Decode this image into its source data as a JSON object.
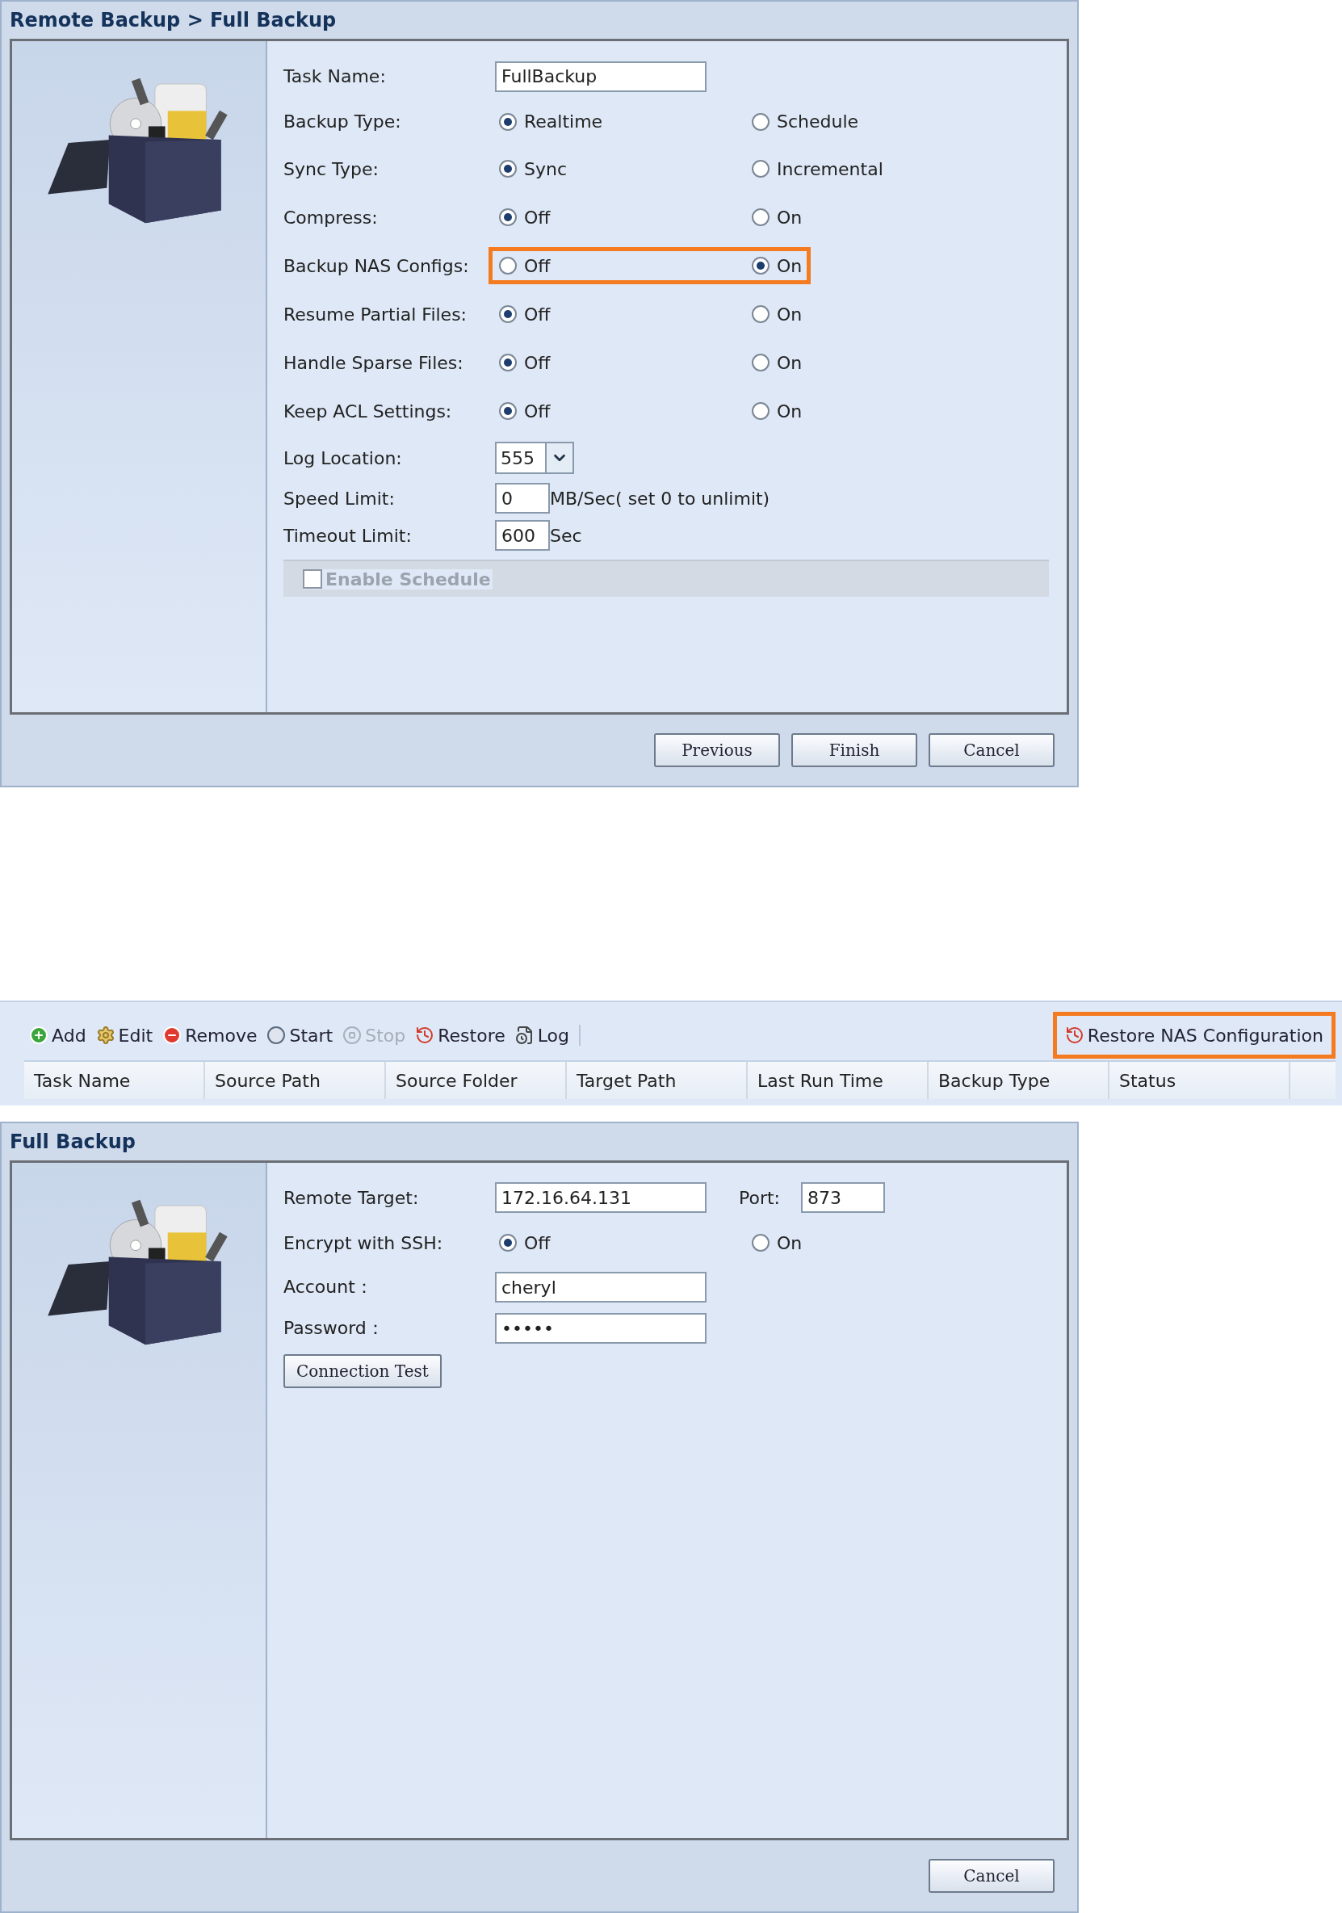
{
  "backup_settings_dialog": {
    "title": "Remote Backup > Full Backup",
    "fields": [
      {
        "kind": "text",
        "label": "Task Name:",
        "value": "FullBackup"
      },
      {
        "kind": "radio",
        "label": "Backup Type:",
        "highlighted": false,
        "options": [
          {
            "label": "Realtime",
            "selected": true
          },
          {
            "label": "Schedule",
            "selected": false
          }
        ]
      },
      {
        "kind": "radio",
        "label": "Sync Type:",
        "highlighted": false,
        "options": [
          {
            "label": "Sync",
            "selected": true
          },
          {
            "label": "Incremental",
            "selected": false
          }
        ]
      },
      {
        "kind": "radio",
        "label": "Compress:",
        "highlighted": false,
        "options": [
          {
            "label": "Off",
            "selected": true
          },
          {
            "label": "On",
            "selected": false
          }
        ]
      },
      {
        "kind": "radio",
        "label": "Backup NAS Configs:",
        "highlighted": true,
        "options": [
          {
            "label": "Off",
            "selected": false
          },
          {
            "label": "On",
            "selected": true
          }
        ]
      },
      {
        "kind": "radio",
        "label": "Resume Partial Files:",
        "highlighted": false,
        "options": [
          {
            "label": "Off",
            "selected": true
          },
          {
            "label": "On",
            "selected": false
          }
        ]
      },
      {
        "kind": "radio",
        "label": "Handle Sparse Files:",
        "highlighted": false,
        "options": [
          {
            "label": "Off",
            "selected": true
          },
          {
            "label": "On",
            "selected": false
          }
        ]
      },
      {
        "kind": "radio",
        "label": "Keep ACL Settings:",
        "highlighted": false,
        "options": [
          {
            "label": "Off",
            "selected": true
          },
          {
            "label": "On",
            "selected": false
          }
        ]
      },
      {
        "kind": "select",
        "label": "Log Location:",
        "value": "555"
      },
      {
        "kind": "unit",
        "label": "Speed Limit:",
        "value": "0",
        "unit": "MB/Sec( set 0 to unlimit)"
      },
      {
        "kind": "unit",
        "label": "Timeout Limit:",
        "value": "600",
        "unit": "Sec"
      },
      {
        "kind": "checkbox",
        "label": "Enable Schedule",
        "checked": false,
        "disabled": true
      }
    ],
    "buttons": [
      "Previous",
      "Finish",
      "Cancel"
    ]
  },
  "task_list": {
    "toolbar": [
      {
        "label": "Add",
        "disabled": false
      },
      {
        "label": "Edit",
        "disabled": false
      },
      {
        "label": "Remove",
        "disabled": false
      },
      {
        "label": "Start",
        "disabled": false
      },
      {
        "label": "Stop",
        "disabled": true
      },
      {
        "label": "Restore",
        "disabled": false
      },
      {
        "label": "Log",
        "disabled": false
      }
    ],
    "restore_config_button": {
      "label": "Restore NAS Configuration",
      "highlighted": true
    },
    "columns": [
      "Task Name",
      "Source Path",
      "Source Folder",
      "Target Path",
      "Last Run Time",
      "Backup Type",
      "Status"
    ]
  },
  "connection_dialog": {
    "title": "Full Backup",
    "fields": [
      {
        "kind": "pair",
        "label": "Remote Target:",
        "value": "172.16.64.131",
        "label2": "Port:",
        "value2": "873"
      },
      {
        "kind": "radio",
        "label": "Encrypt with SSH:",
        "highlighted": false,
        "options": [
          {
            "label": "Off",
            "selected": true
          },
          {
            "label": "On",
            "selected": false
          }
        ]
      },
      {
        "kind": "text",
        "label": "Account：",
        "value": "cheryl"
      },
      {
        "kind": "text",
        "label": "Password：",
        "value": "•••••"
      },
      {
        "kind": "button",
        "label": "Connection Test"
      }
    ],
    "buttons": [
      "Cancel"
    ]
  }
}
